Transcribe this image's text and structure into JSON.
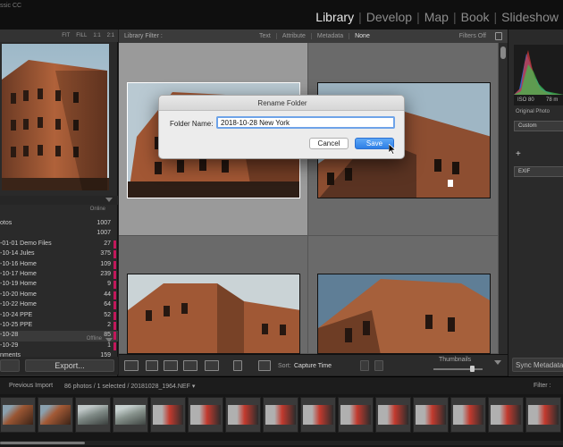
{
  "app": {
    "name_fragment": "ssic CC"
  },
  "modules": [
    "Library",
    "Develop",
    "Map",
    "Book",
    "Slideshow"
  ],
  "active_module": "Library",
  "navigator": {
    "zoom_options": [
      "FIT",
      "FILL",
      "1:1",
      "2:1"
    ]
  },
  "folders": {
    "online_label": "Online",
    "offline_label": "Offline",
    "items": [
      {
        "name": "otos",
        "count": "1007",
        "marked": false
      },
      {
        "name": "",
        "count": "1007",
        "marked": false
      },
      {
        "name": "-01-01 Demo Files",
        "count": "27",
        "marked": true
      },
      {
        "name": "-10-14 Jules",
        "count": "375",
        "marked": true
      },
      {
        "name": "-10-16 Home",
        "count": "109",
        "marked": true
      },
      {
        "name": "-10-17 Home",
        "count": "239",
        "marked": true
      },
      {
        "name": "-10-19 Home",
        "count": "9",
        "marked": true
      },
      {
        "name": "-10-20 Home",
        "count": "44",
        "marked": true
      },
      {
        "name": "-10-22 Home",
        "count": "64",
        "marked": true
      },
      {
        "name": "-10-24 PPE",
        "count": "52",
        "marked": true
      },
      {
        "name": "-10-25 PPE",
        "count": "2",
        "marked": true
      },
      {
        "name": "-10-28",
        "count": "85",
        "marked": true
      },
      {
        "name": "-10-29",
        "count": "1",
        "marked": true
      },
      {
        "name": "nments",
        "count": "159",
        "marked": false
      }
    ]
  },
  "left_buttons": {
    "export": "Export..."
  },
  "filter_bar": {
    "label": "Library Filter :",
    "options": [
      "Text",
      "Attribute",
      "Metadata",
      "None"
    ],
    "active_option": "None",
    "status": "Filters Off"
  },
  "toolbar": {
    "sort_label": "Sort:",
    "sort_value": "Capture Time",
    "thumbnails_label": "Thumbnails"
  },
  "right_panel": {
    "iso": "ISO 80",
    "focal_fragment": "78 m",
    "original_photo": "Original Photo",
    "preset": "Custom",
    "plus": "+",
    "metadata_set": "EXIF",
    "sync_button": "Sync Metadata"
  },
  "filmstrip": {
    "source": "Previous Import",
    "info": "86 photos / 1 selected / 20181028_1964.NEF ▾",
    "filter_label": "Filter :"
  },
  "dialog": {
    "title": "Rename Folder",
    "field_label": "Folder Name:",
    "field_value": "2018-10-28 New York",
    "cancel_label": "Cancel",
    "save_label": "Save"
  },
  "colors": {
    "accent_blue": "#3b8cf0",
    "folder_mark": "#c2185b"
  }
}
